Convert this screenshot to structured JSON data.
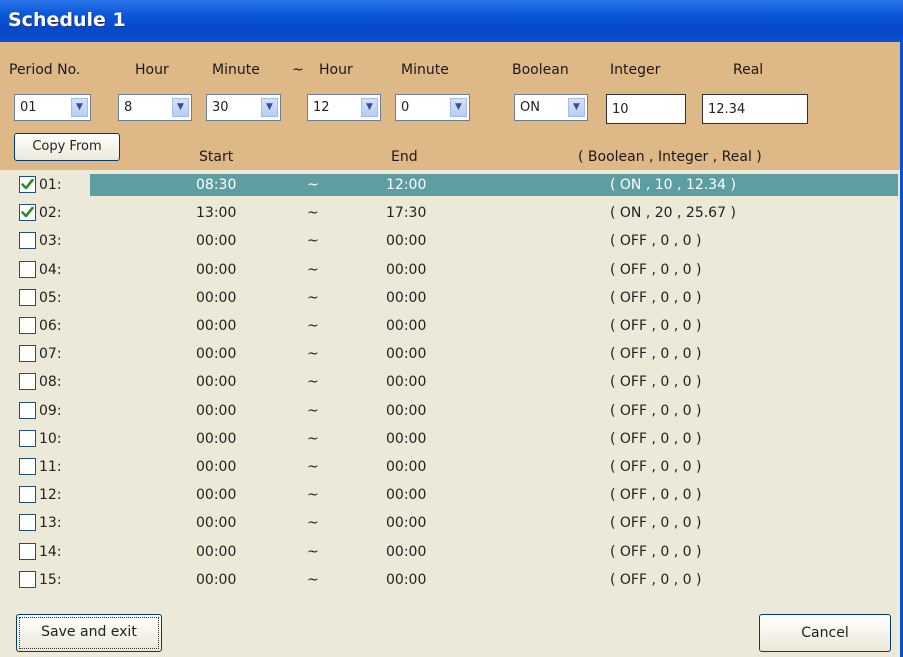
{
  "window": {
    "title": "Schedule 1"
  },
  "header_labels": {
    "period_no": "Period No.",
    "hour_start": "Hour",
    "minute_start": "Minute",
    "tilde": "~",
    "hour_end": "Hour",
    "minute_end": "Minute",
    "boolean": "Boolean",
    "integer": "Integer",
    "real": "Real"
  },
  "inputs": {
    "period": "01",
    "start_hour": "8",
    "start_minute": "30",
    "end_hour": "12",
    "end_minute": "0",
    "boolean": "ON",
    "integer": "10",
    "real": "12.34"
  },
  "buttons": {
    "copy_from": "Copy From",
    "save_exit": "Save and exit",
    "cancel": "Cancel"
  },
  "columns": {
    "start": "Start",
    "end": "End",
    "values": "( Boolean , Integer , Real )"
  },
  "rows": [
    {
      "num": "01:",
      "checked": true,
      "start": "08:30",
      "sep": "~",
      "end": "12:00",
      "values": "( ON , 10 , 12.34 )"
    },
    {
      "num": "02:",
      "checked": true,
      "start": "13:00",
      "sep": "~",
      "end": "17:30",
      "values": "( ON , 20 , 25.67 )"
    },
    {
      "num": "03:",
      "checked": false,
      "start": "00:00",
      "sep": "~",
      "end": "00:00",
      "values": "( OFF , 0 , 0 )"
    },
    {
      "num": "04:",
      "checked": false,
      "start": "00:00",
      "sep": "~",
      "end": "00:00",
      "values": "( OFF , 0 , 0 )"
    },
    {
      "num": "05:",
      "checked": false,
      "start": "00:00",
      "sep": "~",
      "end": "00:00",
      "values": "( OFF , 0 , 0 )"
    },
    {
      "num": "06:",
      "checked": false,
      "start": "00:00",
      "sep": "~",
      "end": "00:00",
      "values": "( OFF , 0 , 0 )"
    },
    {
      "num": "07:",
      "checked": false,
      "start": "00:00",
      "sep": "~",
      "end": "00:00",
      "values": "( OFF , 0 , 0 )"
    },
    {
      "num": "08:",
      "checked": false,
      "start": "00:00",
      "sep": "~",
      "end": "00:00",
      "values": "( OFF , 0 , 0 )"
    },
    {
      "num": "09:",
      "checked": false,
      "start": "00:00",
      "sep": "~",
      "end": "00:00",
      "values": "( OFF , 0 , 0 )"
    },
    {
      "num": "10:",
      "checked": false,
      "start": "00:00",
      "sep": "~",
      "end": "00:00",
      "values": "( OFF , 0 , 0 )"
    },
    {
      "num": "11:",
      "checked": false,
      "start": "00:00",
      "sep": "~",
      "end": "00:00",
      "values": "( OFF , 0 , 0 )"
    },
    {
      "num": "12:",
      "checked": false,
      "start": "00:00",
      "sep": "~",
      "end": "00:00",
      "values": "( OFF , 0 , 0 )"
    },
    {
      "num": "13:",
      "checked": false,
      "start": "00:00",
      "sep": "~",
      "end": "00:00",
      "values": "( OFF , 0 , 0 )"
    },
    {
      "num": "14:",
      "checked": false,
      "start": "00:00",
      "sep": "~",
      "end": "00:00",
      "values": "( OFF , 0 , 0 )"
    },
    {
      "num": "15:",
      "checked": false,
      "start": "00:00",
      "sep": "~",
      "end": "00:00",
      "values": "( OFF , 0 , 0 )"
    }
  ],
  "selected_row": 0,
  "colors": {
    "title_bar": "#0648c8",
    "header_bg": "#deb887",
    "selection": "#5f9ea0",
    "check": "#2e8b2e"
  }
}
